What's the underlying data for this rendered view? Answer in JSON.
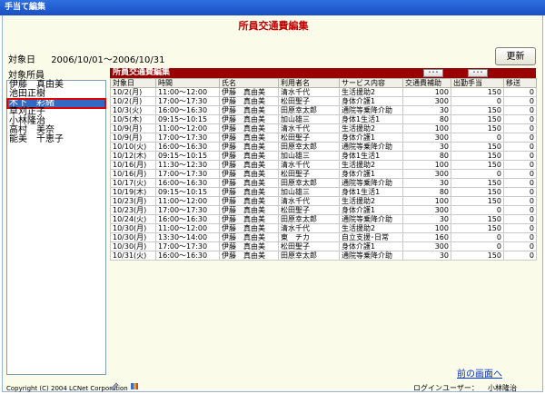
{
  "window": {
    "title": "手当て編集"
  },
  "page": {
    "title": "所員交通費編集",
    "date_label": "対象日",
    "date_range": "2006/10/01～2006/10/31",
    "update_button": "更新"
  },
  "staff": {
    "label": "対象所員",
    "items": [
      "伊藤　真由美",
      "池田正樹",
      "木下　彩緒",
      "草刈正子",
      "小林隆治",
      "高村　美奈",
      "能美　千恵子"
    ],
    "selected_index": 2
  },
  "grid": {
    "title": "所員交通費編集",
    "more_buttons": [
      "･･･",
      "･･･"
    ],
    "columns": [
      "対象日",
      "時間",
      "氏名",
      "利用者名",
      "サービス内容",
      "交通費補助",
      "出勤手当",
      "移送"
    ],
    "rows": [
      [
        "10/2(月)",
        "11:00～12:00",
        "伊藤　真由美",
        "清水千代",
        "生活援助2",
        "100",
        "150",
        "0"
      ],
      [
        "10/2(月)",
        "17:00～17:30",
        "伊藤　真由美",
        "松田聖子",
        "身体介護1",
        "300",
        "0",
        "0"
      ],
      [
        "10/3(火)",
        "16:00～16:30",
        "伊藤　真由美",
        "田原幸太郎",
        "通院等乗降介助",
        "30",
        "150",
        "0"
      ],
      [
        "10/5(木)",
        "09:15～10:15",
        "伊藤　真由美",
        "加山雄三",
        "身体1生活1",
        "80",
        "150",
        "0"
      ],
      [
        "10/9(月)",
        "11:00～12:00",
        "伊藤　真由美",
        "清水千代",
        "生活援助2",
        "100",
        "150",
        "0"
      ],
      [
        "10/9(月)",
        "17:00～17:30",
        "伊藤　真由美",
        "松田聖子",
        "身体介護1",
        "300",
        "0",
        "0"
      ],
      [
        "10/10(火)",
        "16:00～16:30",
        "伊藤　真由美",
        "田原幸太郎",
        "通院等乗降介助",
        "30",
        "150",
        "0"
      ],
      [
        "10/12(木)",
        "09:15～10:15",
        "伊藤　真由美",
        "加山雄三",
        "身体1生活1",
        "80",
        "150",
        "0"
      ],
      [
        "10/16(月)",
        "11:30～12:30",
        "伊藤　真由美",
        "清水千代",
        "生活援助2",
        "100",
        "150",
        "0"
      ],
      [
        "10/16(月)",
        "17:00～17:30",
        "伊藤　真由美",
        "松田聖子",
        "身体介護1",
        "300",
        "0",
        "0"
      ],
      [
        "10/17(火)",
        "16:00～16:30",
        "伊藤　真由美",
        "田原幸太郎",
        "通院等乗降介助",
        "30",
        "150",
        "0"
      ],
      [
        "10/19(木)",
        "09:15～10:15",
        "伊藤　真由美",
        "加山雄三",
        "身体1生活1",
        "80",
        "150",
        "0"
      ],
      [
        "10/23(月)",
        "11:00～12:00",
        "伊藤　真由美",
        "清水千代",
        "生活援助2",
        "100",
        "150",
        "0"
      ],
      [
        "10/23(月)",
        "17:00～17:30",
        "伊藤　真由美",
        "松田聖子",
        "身体介護1",
        "300",
        "0",
        "0"
      ],
      [
        "10/24(火)",
        "16:00～16:30",
        "伊藤　真由美",
        "田原幸太郎",
        "通院等乗降介助",
        "30",
        "150",
        "0"
      ],
      [
        "10/30(月)",
        "11:00～12:00",
        "伊藤　真由美",
        "清水千代",
        "生活援助2",
        "100",
        "150",
        "0"
      ],
      [
        "10/30(月)",
        "13:30～14:00",
        "伊藤　真由美",
        "東　チカ",
        "自立支援･日常",
        "160",
        "0",
        "0"
      ],
      [
        "10/30(月)",
        "17:00～17:30",
        "伊藤　真由美",
        "松田聖子",
        "身体介護1",
        "300",
        "0",
        "0"
      ],
      [
        "10/31(火)",
        "16:00～16:30",
        "伊藤　真由美",
        "田原幸太郎",
        "通院等乗降介助",
        "30",
        "150",
        "0"
      ]
    ]
  },
  "footer": {
    "back_link": "前の画面へ",
    "copyright": "Copyright (C) 2004 LCNet Corporation",
    "login_label": "ログインユーザー：",
    "login_user": "小林隆治"
  }
}
